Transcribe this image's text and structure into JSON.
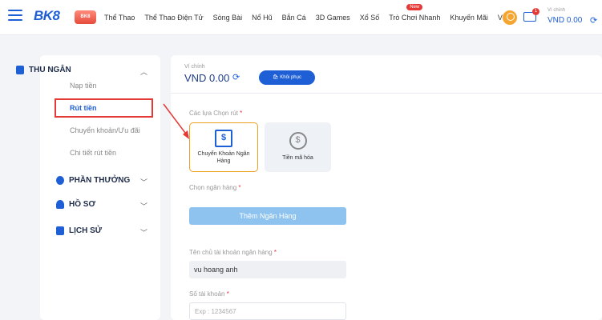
{
  "header": {
    "logo_text": "BK8",
    "badge_logo_text": "BK8",
    "nav": [
      {
        "label": "Thể Thao"
      },
      {
        "label": "Thể Thao Điện Tử"
      },
      {
        "label": "Sòng Bài"
      },
      {
        "label": "Nổ Hũ"
      },
      {
        "label": "Bắn Cá"
      },
      {
        "label": "3D Games"
      },
      {
        "label": "Xổ Số"
      },
      {
        "label": "Trò Chơi Nhanh",
        "badge": "New"
      },
      {
        "label": "Khuyến Mãi"
      },
      {
        "label": "VIP"
      }
    ],
    "mail_count": "1",
    "wallet_label": "Ví chính",
    "wallet_value": "VND 0.00"
  },
  "sidebar": {
    "thu_ngan": "THU NGÂN",
    "nap_tien": "Nạp tiền",
    "rut_tien": "Rút tiền",
    "chuyen_khoan": "Chuyển khoản/Ưu đãi",
    "chi_tiet": "Chi tiết rút tiền",
    "phan_thuong": "PHẦN THƯỞNG",
    "ho_so": "HỒ SƠ",
    "lich_su": "LỊCH SỬ"
  },
  "main": {
    "vi_label": "Ví chính",
    "vi_value": "VND 0.00",
    "restore_label": "Khôi phục",
    "method_label": "Các lựa Chọn rút",
    "methods": [
      {
        "name": "Chuyển Khoản Ngân Hàng"
      },
      {
        "name": "Tiền mã hóa"
      }
    ],
    "bank_label": "Chọn ngân hàng",
    "add_bank_label": "Thêm Ngân Hàng",
    "holder_label": "Tên chủ tài khoản ngân hàng",
    "holder_value": "vu hoang anh",
    "account_label": "Số tài khoản",
    "account_placeholder": "Exp : 1234567"
  },
  "colors": {
    "brand": "#1e5fd6",
    "highlight": "#e53935",
    "selected_border": "#f0a020"
  }
}
